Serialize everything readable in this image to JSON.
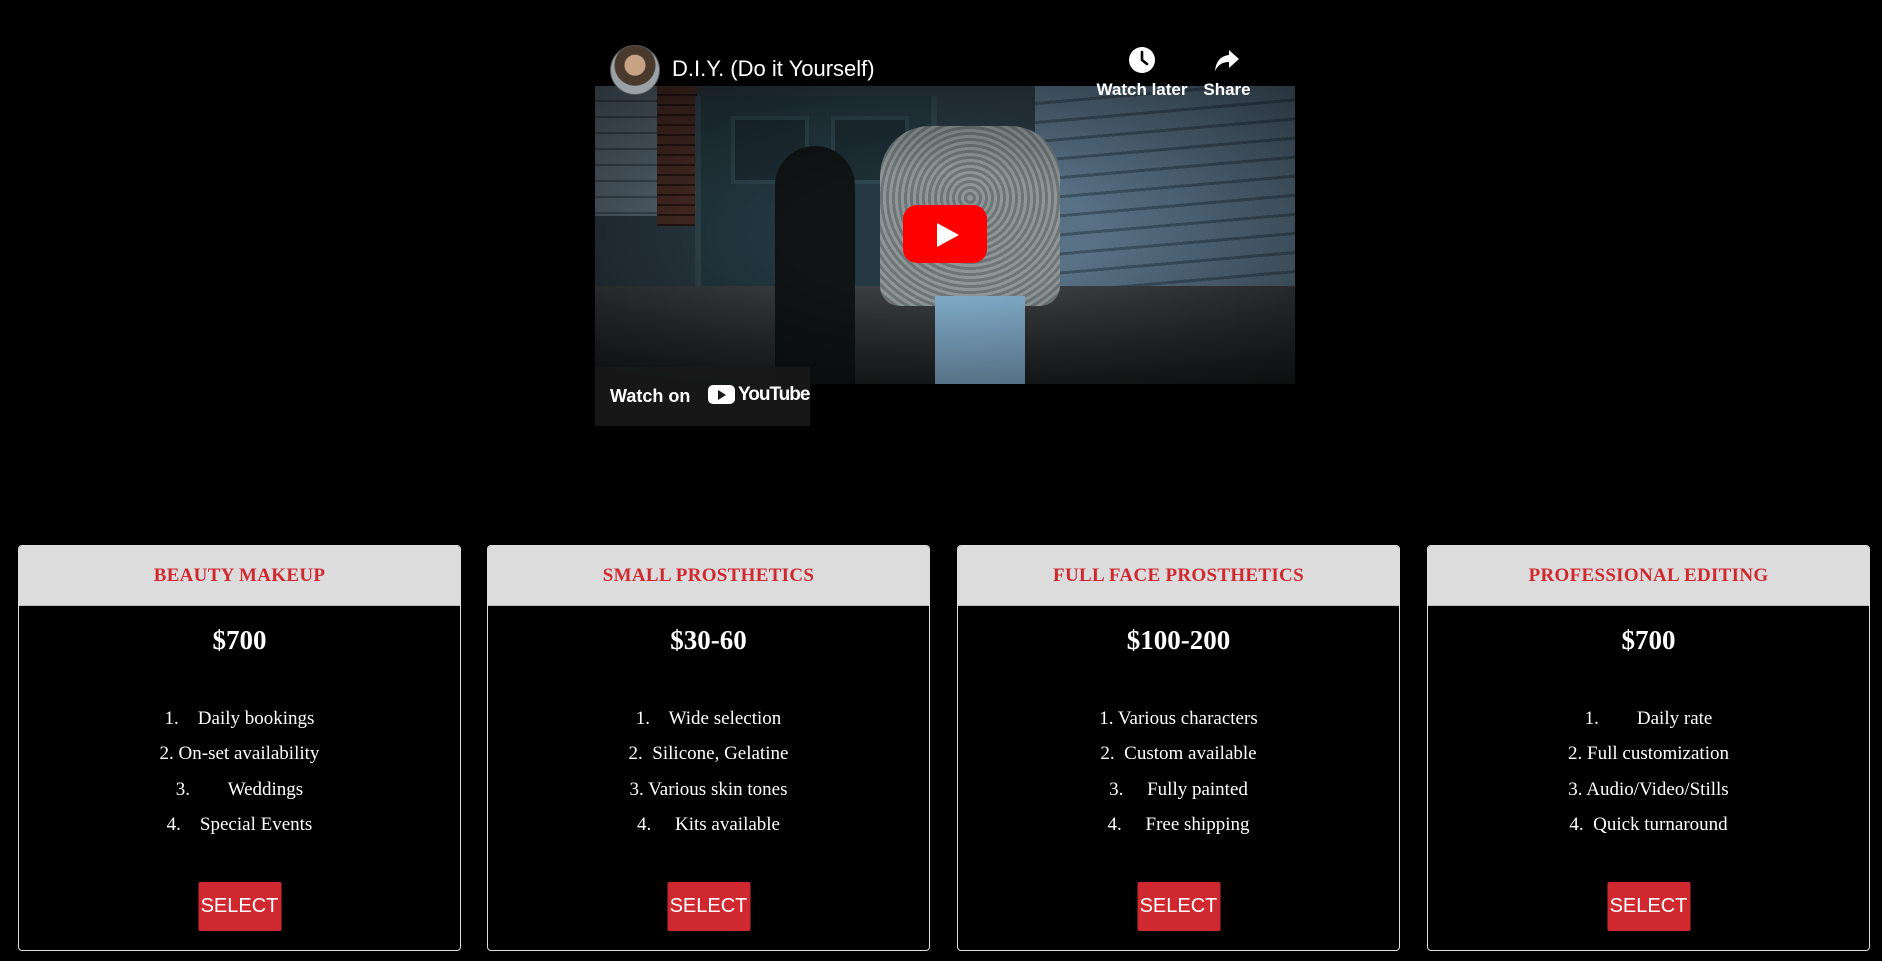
{
  "video": {
    "title": "D.I.Y. (Do it Yourself)",
    "watch_later_label": "Watch later",
    "share_label": "Share",
    "watch_on_label": "Watch on",
    "youtube_label": "YouTube"
  },
  "colors": {
    "accent": "#d0282f",
    "header_bg": "#dcdcdc",
    "background": "#000000",
    "play_red": "#ff0000"
  },
  "plans": [
    {
      "name": "BEAUTY MAKEUP",
      "price": "$700",
      "features": [
        "1.    Daily bookings",
        "2. On-set availability",
        "3.        Weddings",
        "4.    Special Events"
      ],
      "button": "SELECT"
    },
    {
      "name": "SMALL PROSTHETICS",
      "price": "$30-60",
      "features": [
        "1.    Wide selection",
        "2.  Silicone, Gelatine",
        "3. Various skin tones",
        "4.     Kits available"
      ],
      "button": "SELECT"
    },
    {
      "name": "FULL FACE PROSTHETICS",
      "price": "$100-200",
      "features": [
        "1. Various characters",
        "2.  Custom available",
        "3.     Fully painted",
        "4.     Free shipping"
      ],
      "button": "SELECT"
    },
    {
      "name": "PROFESSIONAL EDITING",
      "price": "$700",
      "features": [
        "1.        Daily rate",
        "2. Full customization",
        "3. Audio/Video/Stills",
        "4.  Quick turnaround"
      ],
      "button": "SELECT"
    }
  ]
}
